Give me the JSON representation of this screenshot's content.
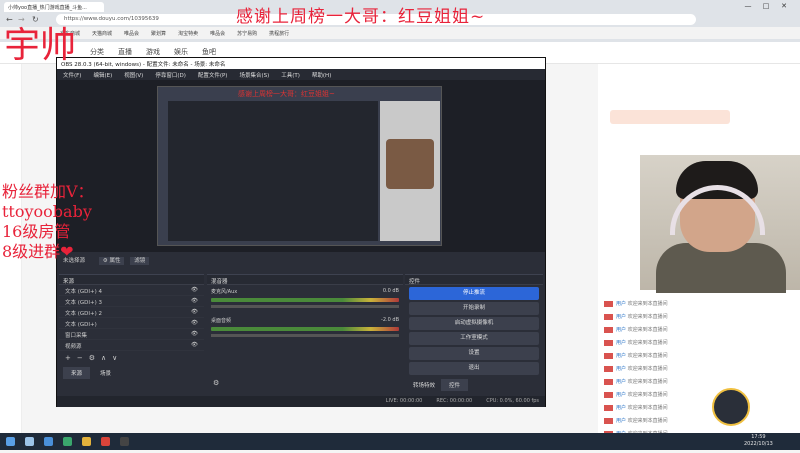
{
  "browser": {
    "tab_title": "小帅yoo直播_热门游戏直播_斗鱼...",
    "url": "https://www.douyu.com/10395639",
    "bookmarks": [
      "京东商城",
      "天猫商城",
      "唯品会",
      "聚划算",
      "淘宝特卖",
      "唯品会",
      "苏宁易购",
      "携程旅行"
    ],
    "window_buttons": [
      "—",
      "□",
      "✕"
    ]
  },
  "site": {
    "nav": [
      "分类",
      "直播",
      "游戏",
      "娱乐",
      "鱼吧"
    ],
    "accent": "#ff5d23"
  },
  "overlays": {
    "top_banner": "感谢上周榜一大哥：红豆姐姐~",
    "top_left_name": "宇帅",
    "fan_lines": [
      "粉丝群加V：",
      "ttoyoobaby",
      "16级房管",
      "8级进群❤"
    ],
    "accent_red": "#e8233a"
  },
  "obs": {
    "title": "OBS 28.0.3 (64-bit, windows) - 配置文件: 未命名 - 场景: 未命名",
    "menu": [
      "文件(F)",
      "编辑(E)",
      "视图(V)",
      "停靠窗口(D)",
      "配置文件(P)",
      "场景集合(S)",
      "工具(T)",
      "帮助(H)"
    ],
    "inner_banner": "感谢上周榜一大哥：红豆姐姐~",
    "scene_bar": [
      "⚙ 属性",
      "滤镜"
    ],
    "scene_label": "未选择源",
    "sources_header": "来源",
    "sources": [
      {
        "name": "文本 (GDI+) 4"
      },
      {
        "name": "文本 (GDI+) 3"
      },
      {
        "name": "文本 (GDI+) 2"
      },
      {
        "name": "文本 (GDI+)"
      },
      {
        "name": "窗口采集"
      },
      {
        "name": "视频源"
      }
    ],
    "tabs": [
      "来源",
      "场景"
    ],
    "mixer_header": "混音器",
    "mixer": [
      {
        "name": "麦克风/Aux",
        "db": "0.0 dB"
      },
      {
        "name": "桌面音频",
        "db": "-2.0 dB"
      }
    ],
    "controls_header": "控件",
    "controls": [
      "停止推流",
      "开始录制",
      "启动虚拟摄像机",
      "工作室模式",
      "设置",
      "退出"
    ],
    "bottom_tabs": [
      "转场特效",
      "控件"
    ],
    "status": {
      "live": "LIVE: 00:00:00",
      "rec": "REC: 00:00:00",
      "cpu": "CPU: 0.0%, 60.00 fps"
    }
  },
  "chat": {
    "lines": [
      {
        "name": "用户",
        "text": "欢迎来到本直播间"
      },
      {
        "name": "用户",
        "text": "欢迎来到本直播间"
      },
      {
        "name": "用户",
        "text": "欢迎来到本直播间"
      },
      {
        "name": "用户",
        "text": "欢迎来到本直播间"
      },
      {
        "name": "用户",
        "text": "欢迎来到本直播间"
      },
      {
        "name": "用户",
        "text": "欢迎来到本直播间"
      },
      {
        "name": "用户",
        "text": "欢迎来到本直播间"
      },
      {
        "name": "用户",
        "text": "欢迎来到本直播间"
      },
      {
        "name": "用户",
        "text": "欢迎来到本直播间"
      },
      {
        "name": "用户",
        "text": "欢迎来到本直播间"
      },
      {
        "name": "用户",
        "text": "欢迎来到本直播间"
      },
      {
        "name": "用户",
        "text": "欢迎来到本直播间"
      }
    ]
  },
  "taskbar": {
    "time": "17:59",
    "date": "2022/10/13"
  }
}
